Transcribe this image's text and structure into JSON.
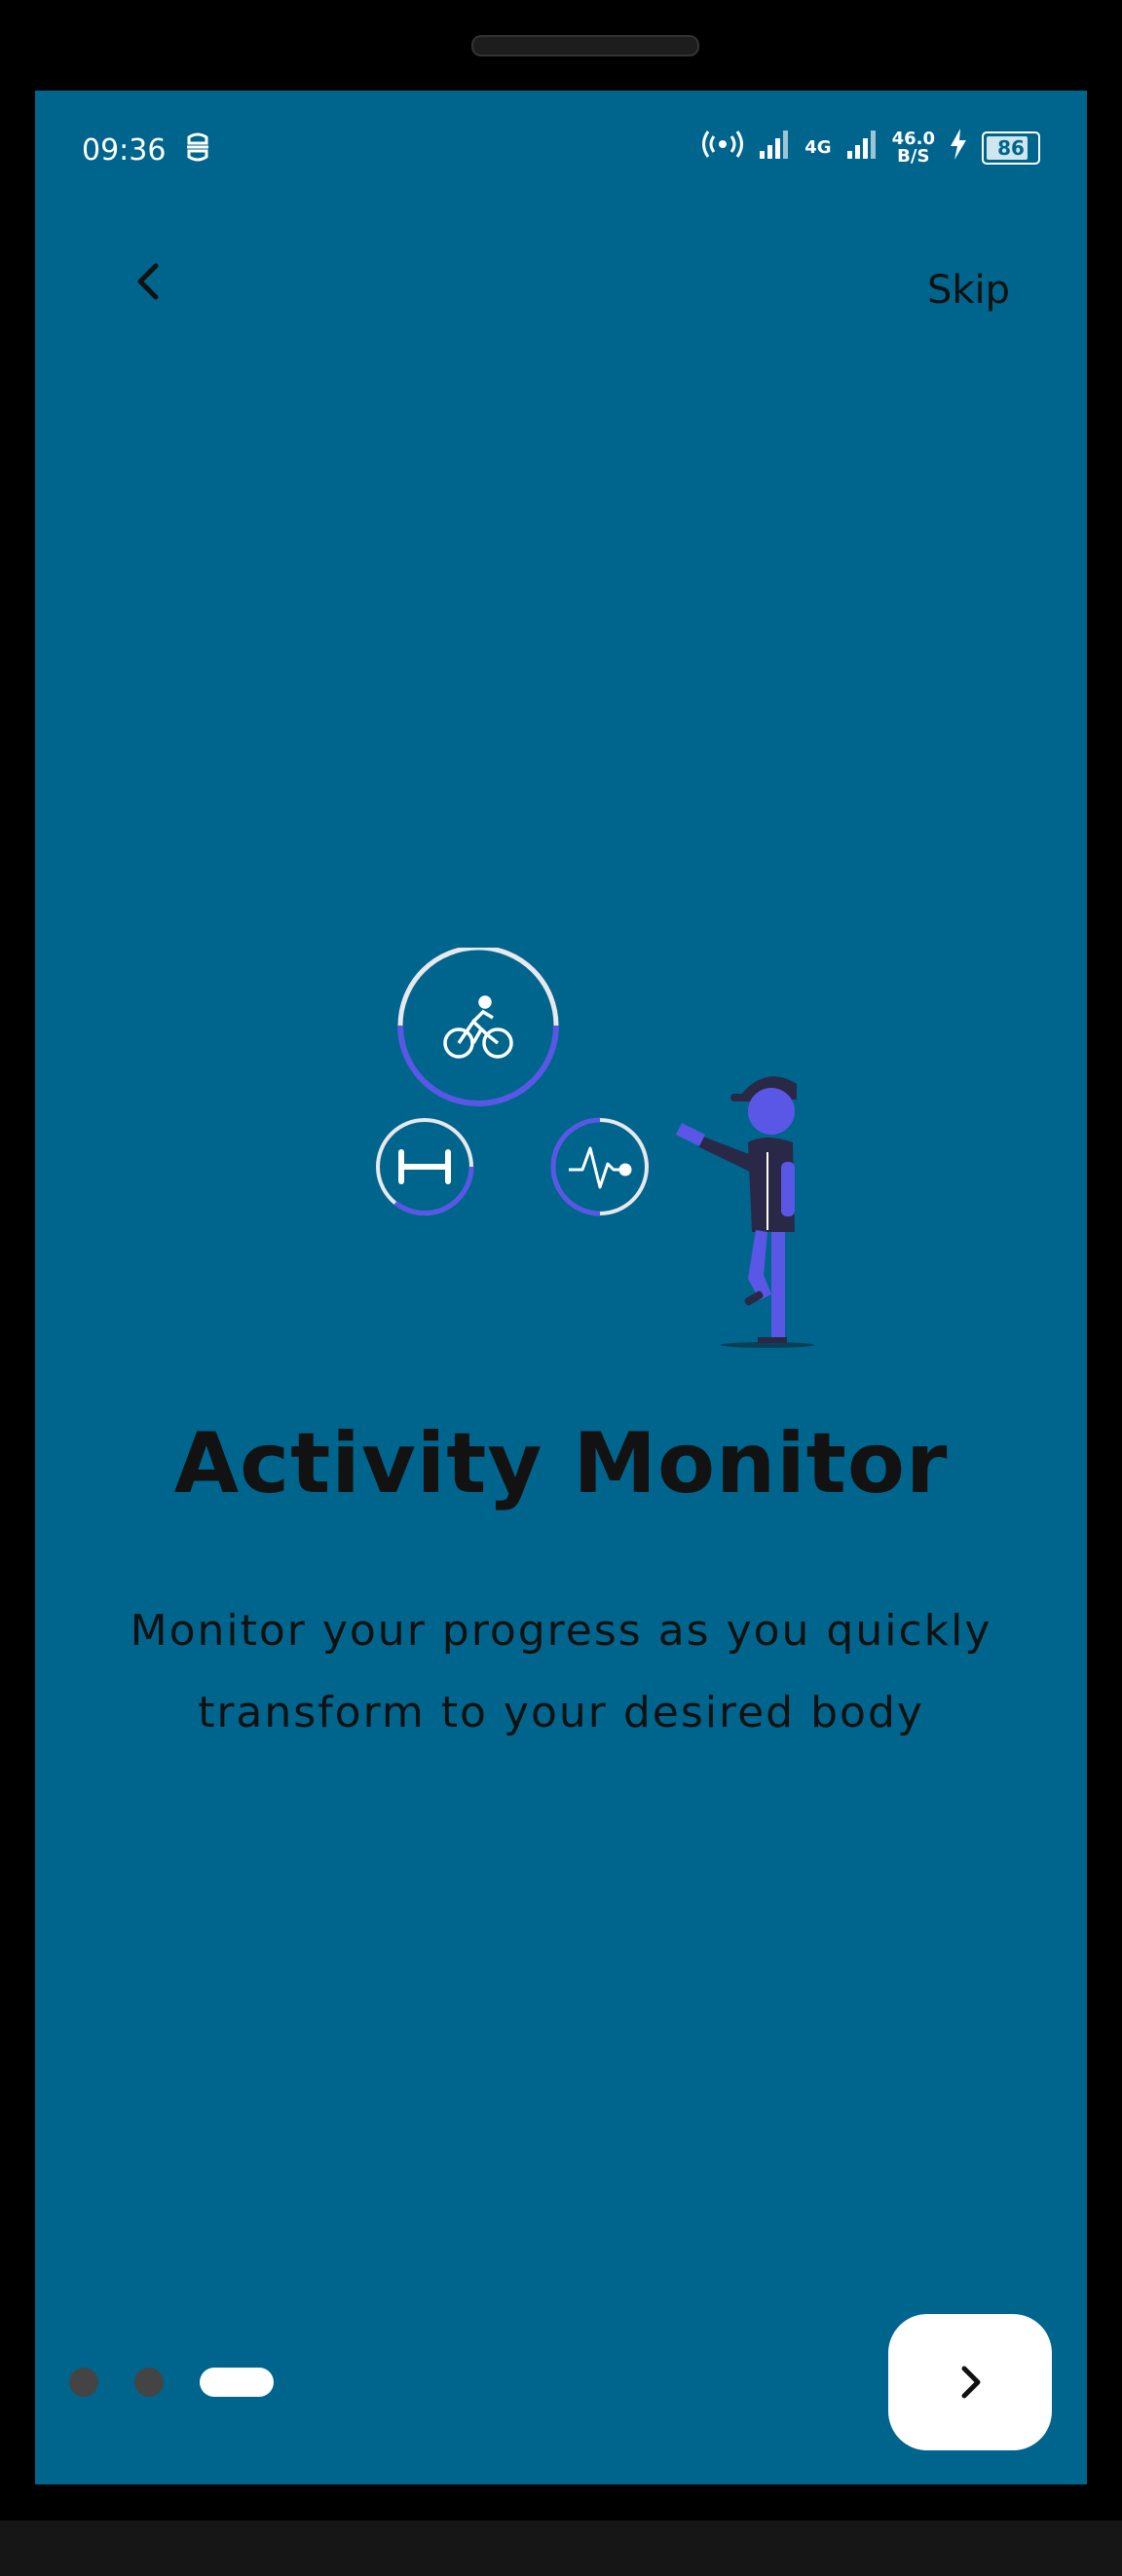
{
  "status_bar": {
    "time": "09:36",
    "network": "4G",
    "data_rate_value": "46.0",
    "data_rate_unit": "B/S",
    "battery": "86"
  },
  "nav": {
    "skip_label": "Skip"
  },
  "onboarding": {
    "title": "Activity Monitor",
    "description": "Monitor your progress as you quickly transform to your desired body",
    "page_index": 3,
    "page_count": 3
  },
  "colors": {
    "background": "#00658d",
    "accent": "#5b57e6",
    "text": "#121212"
  },
  "icons": [
    "back-icon",
    "bicycle-icon",
    "dumbbell-icon",
    "heartbeat-icon",
    "next-arrow-icon"
  ]
}
